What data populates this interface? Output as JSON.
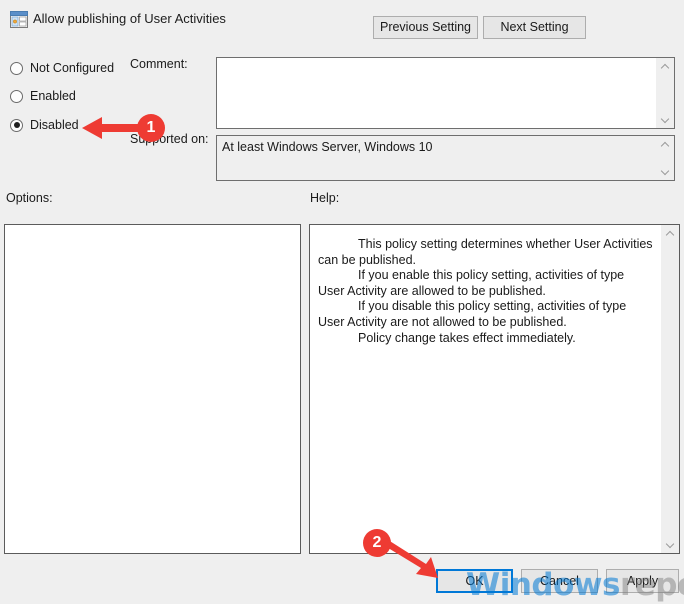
{
  "dialog": {
    "title": "Allow publishing of User Activities",
    "icon": "policy-setting-icon"
  },
  "nav": {
    "previous_label": "Previous Setting",
    "next_label": "Next Setting"
  },
  "state_options": [
    {
      "label": "Not Configured",
      "selected": false
    },
    {
      "label": "Enabled",
      "selected": false
    },
    {
      "label": "Disabled",
      "selected": true
    }
  ],
  "fields": {
    "comment_label": "Comment:",
    "comment_value": "",
    "supported_label": "Supported on:",
    "supported_value": "At least Windows Server, Windows 10"
  },
  "sections": {
    "options_label": "Options:",
    "help_label": "Help:"
  },
  "help": {
    "paragraphs": [
      "This policy setting determines whether User Activities can be published.",
      "If you enable this policy setting, activities of type User Activity are allowed to be published.",
      "If you disable this policy setting, activities of type User Activity are not allowed to be published.",
      "Policy change takes effect immediately."
    ]
  },
  "footer": {
    "ok_label": "OK",
    "cancel_label": "Cancel",
    "apply_label": "Apply"
  },
  "annotations": [
    {
      "number": "1",
      "target": "disabled-radio",
      "direction": "left"
    },
    {
      "number": "2",
      "target": "ok-button",
      "direction": "down-right"
    }
  ],
  "watermark": {
    "part1": "Windows",
    "part2": "report"
  },
  "colors": {
    "accent": "#0078d7",
    "annotation": "#ee3b33",
    "window_bg": "#efefef",
    "panel_bg": "#ffffff",
    "border": "#5b5b5b"
  }
}
